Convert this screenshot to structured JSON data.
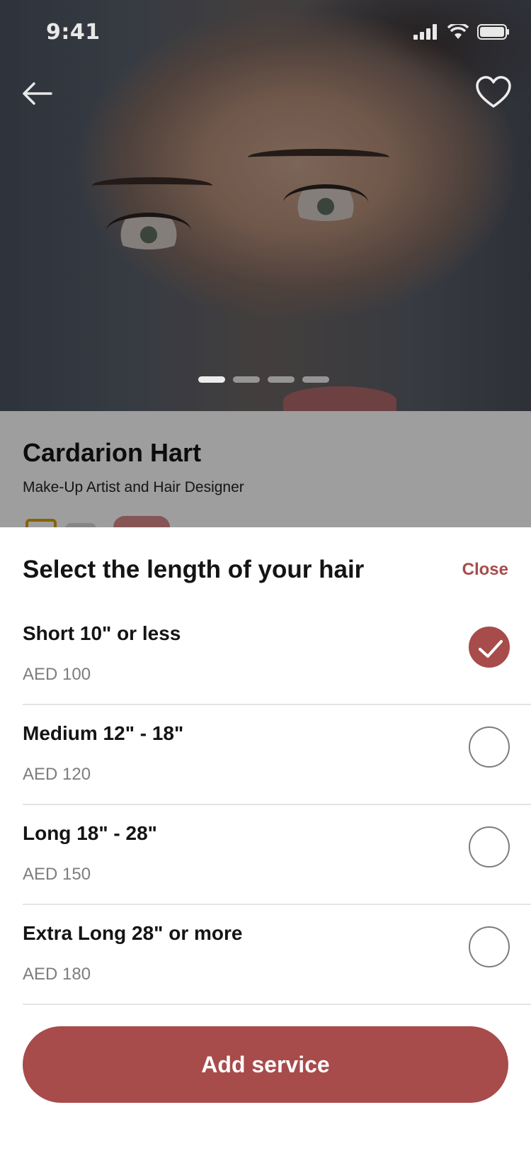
{
  "status_bar": {
    "time": "9:41"
  },
  "profile": {
    "name": "Cardarion Hart",
    "role": "Make-Up Artist and Hair Designer"
  },
  "carousel": {
    "total_slides": 4,
    "active_slide": 1
  },
  "sheet": {
    "title": "Select the length of your hair",
    "close_label": "Close",
    "options": [
      {
        "label": "Short 10\" or less",
        "price": "AED 100",
        "selected": true
      },
      {
        "label": "Medium 12\" - 18\"",
        "price": "AED 120",
        "selected": false
      },
      {
        "label": "Long 18\" - 28\"",
        "price": "AED 150",
        "selected": false
      },
      {
        "label": "Extra Long 28\" or more",
        "price": "AED 180",
        "selected": false
      }
    ],
    "add_button_label": "Add service"
  },
  "colors": {
    "accent": "#a84b4b",
    "text_primary": "#141414",
    "text_secondary": "#7d7d7d",
    "divider": "#e4e4e4"
  },
  "icons": [
    "back-arrow-icon",
    "heart-icon",
    "signal-icon",
    "wifi-icon",
    "battery-icon",
    "checkmark-icon"
  ]
}
